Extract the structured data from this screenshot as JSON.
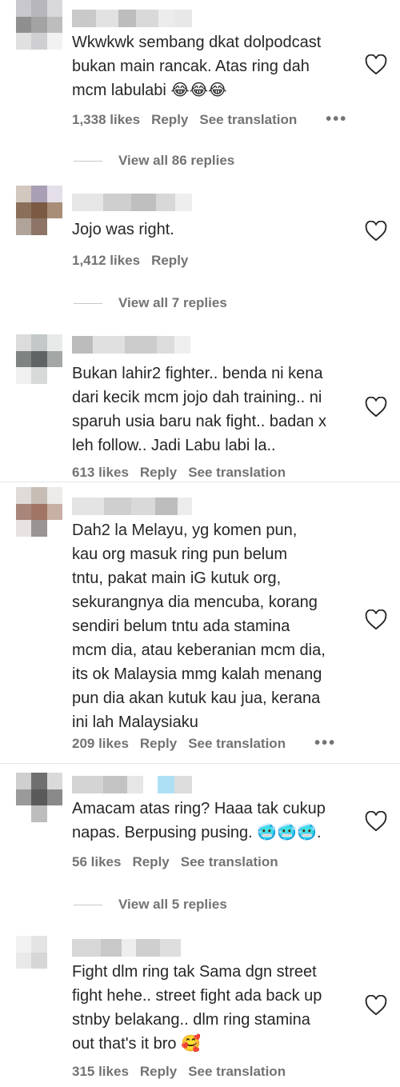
{
  "comments": [
    {
      "text": "Wkwkwk sembang dkat dolpodcast\nbukan main rancak. Atas ring dah\nmcm labulabi",
      "emoji": "😂😂😂",
      "likes": "1,338 likes",
      "reply": "Reply",
      "translation": "See translation",
      "more": "•••",
      "view_replies": "View all 86 replies"
    },
    {
      "text": "Jojo was right.",
      "emoji": "",
      "likes": "1,412 likes",
      "reply": "Reply",
      "view_replies": "View all 7 replies"
    },
    {
      "text": "Bukan lahir2 fighter.. benda ni kena\ndari kecik mcm jojo dah training.. ni\nsparuh usia baru nak fight.. badan x\nleh follow.. Jadi Labu labi la..",
      "emoji": "",
      "likes": "613 likes",
      "reply": "Reply",
      "translation": "See translation"
    },
    {
      "text": "Dah2 la Melayu, yg komen pun,\nkau org masuk ring pun belum\ntntu, pakat main iG kutuk org,\nsekurangnya dia mencuba, korang\nsendiri belum tntu ada stamina\nmcm dia, atau keberanian mcm dia,\nits ok Malaysia mmg kalah menang\npun dia akan kutuk kau jua, kerana\nini lah Malaysiaku",
      "emoji": "",
      "likes": "209 likes",
      "reply": "Reply",
      "translation": "See translation",
      "more": "•••"
    },
    {
      "text": "Amacam atas ring? Haaa tak cukup\nnapas. Berpusing pusing.",
      "emoji": "🥶🥶🥶.",
      "likes": "56 likes",
      "reply": "Reply",
      "translation": "See translation",
      "view_replies": "View all 5 replies"
    },
    {
      "text": "Fight dlm ring tak Sama dgn street\nfight hehe.. street fight ada back up\nstnby belakang.. dlm ring stamina\nout that's it bro",
      "emoji": "🥰",
      "likes": "315 likes",
      "reply": "Reply",
      "translation": "See translation"
    }
  ],
  "colors": {
    "text": "#262626",
    "secondary": "#737373"
  },
  "icons": {
    "like": "heart-outline-icon"
  }
}
